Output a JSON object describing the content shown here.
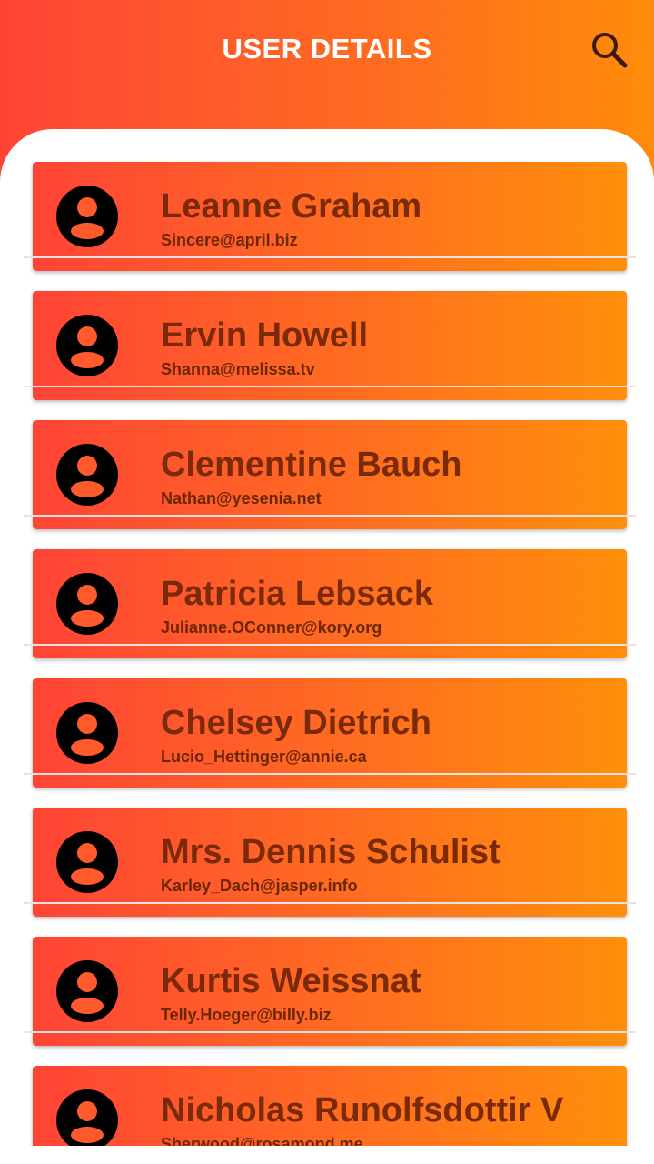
{
  "header": {
    "title": "USER DETAILS",
    "search_icon": "search-icon"
  },
  "users": [
    {
      "name": "Leanne Graham",
      "email": "Sincere@april.biz",
      "icon": "account-circle-icon"
    },
    {
      "name": "Ervin Howell",
      "email": "Shanna@melissa.tv",
      "icon": "account-circle-icon"
    },
    {
      "name": "Clementine Bauch",
      "email": "Nathan@yesenia.net",
      "icon": "account-circle-icon"
    },
    {
      "name": "Patricia Lebsack",
      "email": "Julianne.OConner@kory.org",
      "icon": "account-circle-icon"
    },
    {
      "name": "Chelsey Dietrich",
      "email": "Lucio_Hettinger@annie.ca",
      "icon": "account-circle-icon"
    },
    {
      "name": "Mrs. Dennis Schulist",
      "email": "Karley_Dach@jasper.info",
      "icon": "account-circle-icon"
    },
    {
      "name": "Kurtis Weissnat",
      "email": "Telly.Hoeger@billy.biz",
      "icon": "account-circle-icon"
    },
    {
      "name": "Nicholas Runolfsdottir V",
      "email": "Sherwood@rosamond.me",
      "icon": "account-circle-icon"
    }
  ],
  "colors": {
    "gradient_start": "#ff4436",
    "gradient_end": "#ff8c0a",
    "name_text": "#7a2a08",
    "email_text": "#6a2606"
  }
}
